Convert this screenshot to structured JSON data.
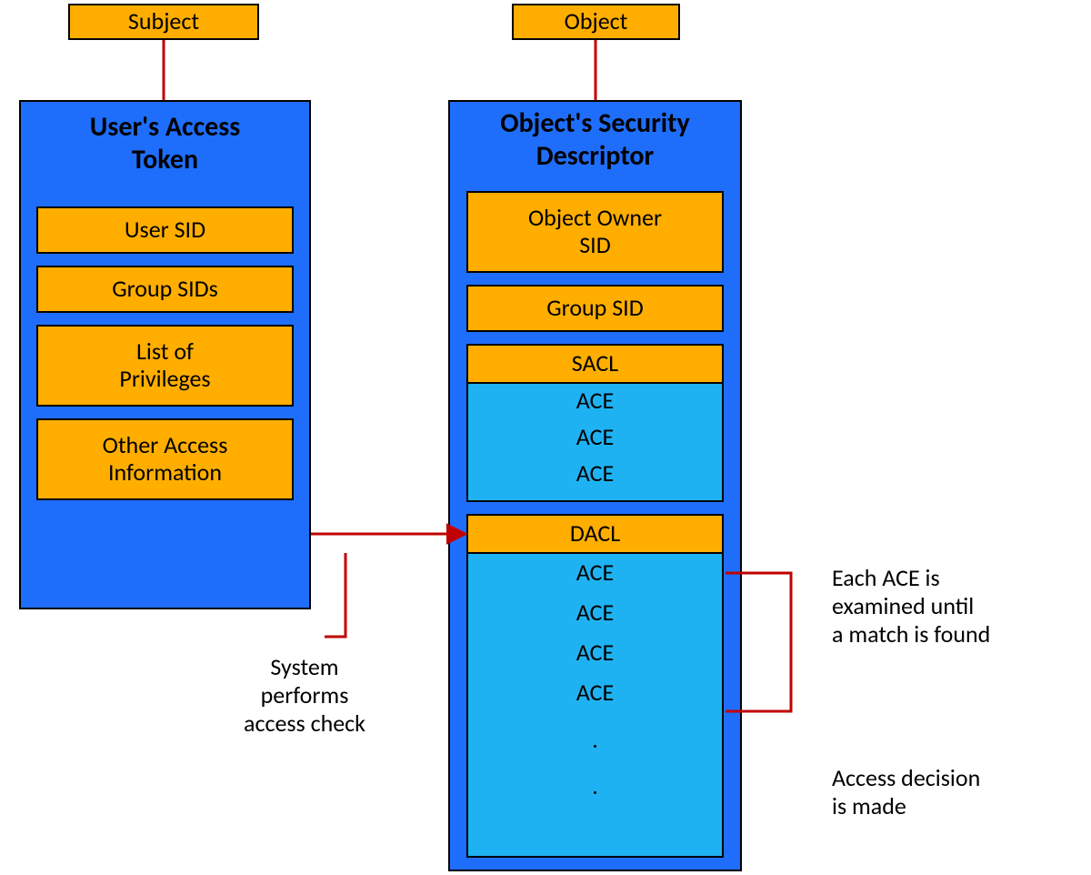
{
  "left": {
    "top_label": "Subject",
    "container_title_line1": "User's Access",
    "container_title_line2": "Token",
    "items": [
      "User SID",
      "Group SIDs",
      "List of\nPrivileges",
      "Other Access\nInformation"
    ]
  },
  "right": {
    "top_label": "Object",
    "container_title_line1": "Object's Security",
    "container_title_line2": "Descriptor",
    "owner_label": "Object Owner\nSID",
    "group_label": "Group SID",
    "sacl": {
      "header": "SACL",
      "entries": [
        "ACE",
        "ACE",
        "ACE"
      ]
    },
    "dacl": {
      "header": "DACL",
      "entries": [
        "ACE",
        "ACE",
        "ACE",
        "ACE",
        ".",
        "."
      ]
    }
  },
  "annotations": {
    "access_check": "System\nperforms\naccess check",
    "each_ace": "Each ACE is\nexamined until\na match is found",
    "decision": "Access decision\nis made"
  }
}
